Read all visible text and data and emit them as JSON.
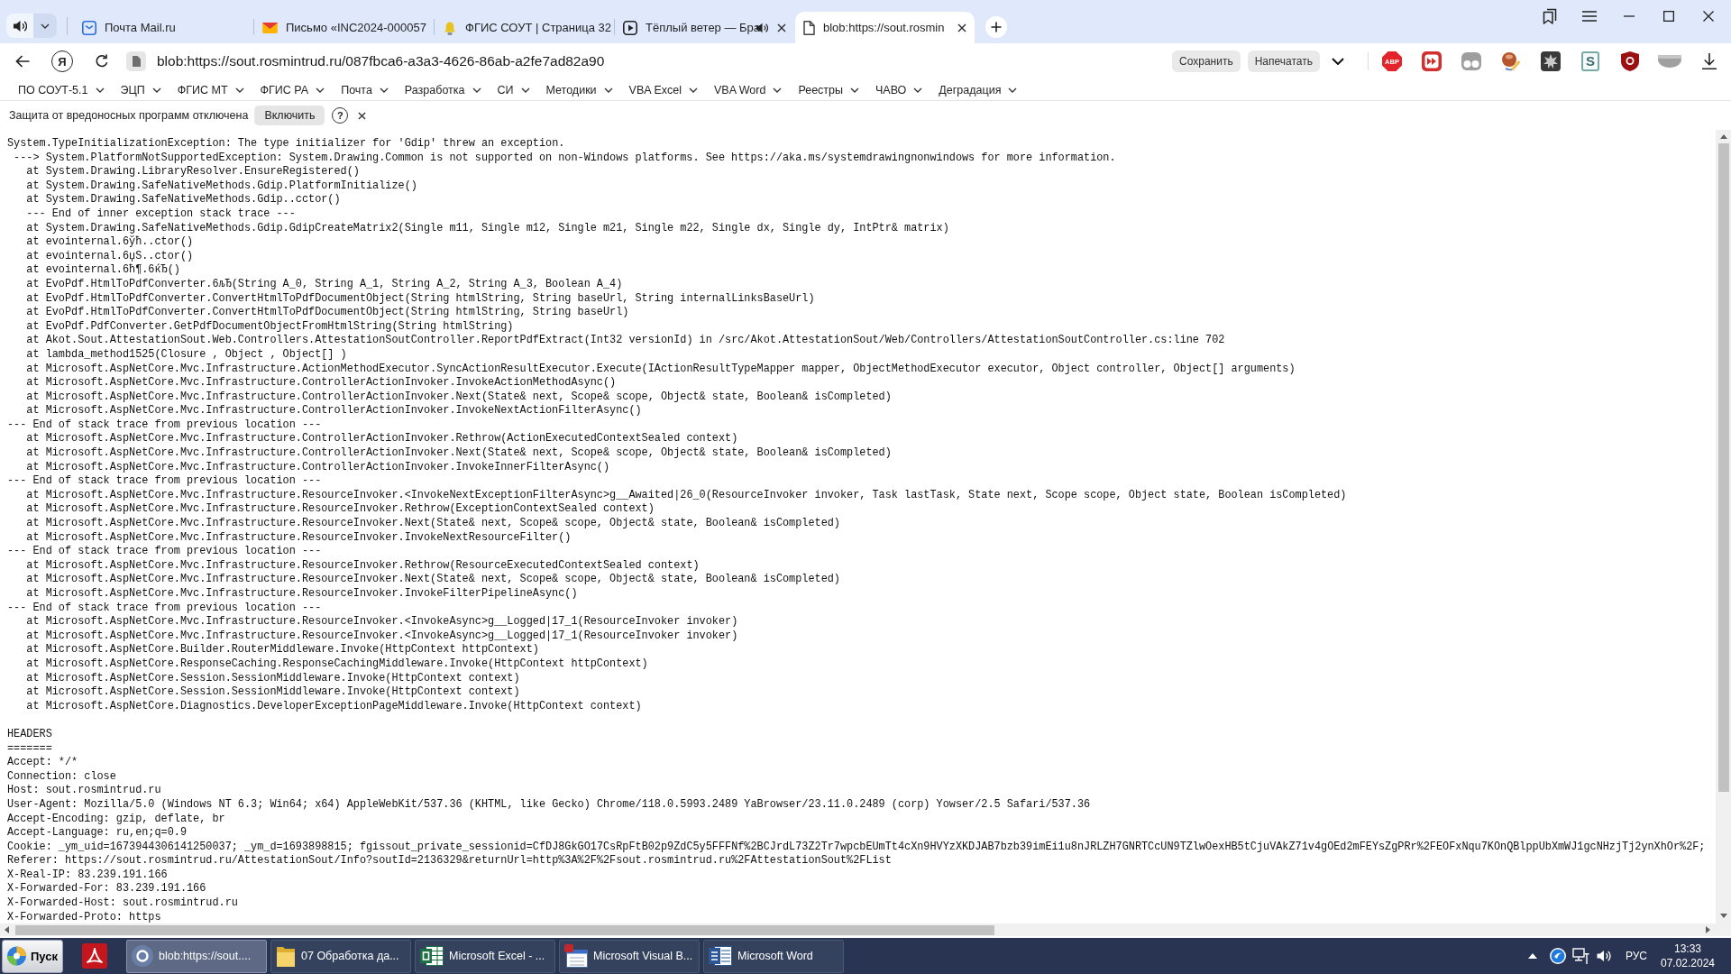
{
  "tab_strip": {
    "tabs": [
      {
        "title": "Почта Mail.ru",
        "selected": false,
        "audio": false,
        "show_close": false
      },
      {
        "title": "Письмо «INC2024-000057",
        "selected": false,
        "audio": false,
        "show_close": false
      },
      {
        "title": "ФГИС СОУТ | Страница 32",
        "selected": false,
        "audio": false,
        "show_close": false
      },
      {
        "title": "Тёплый ветер — Бра",
        "selected": false,
        "audio": true,
        "show_close": true
      },
      {
        "title": "blob:https://sout.rosmin",
        "selected": true,
        "audio": false,
        "show_close": true
      }
    ]
  },
  "toolbar": {
    "logo_letter": "Я",
    "url": "blob:https://sout.rosmintrud.ru/087fbca6-a3a3-4626-86ab-a2fe7ad82a90",
    "buttons": [
      "Сохранить",
      "Напечатать"
    ],
    "abp_badge": "ABP",
    "s_badge": "S"
  },
  "bookmarks_bar": {
    "folders": [
      "ПО СОУТ-5.1",
      "ЭЦП",
      "ФГИС МТ",
      "ФГИС РА",
      "Почта",
      "Разработка",
      "СИ",
      "Методики",
      "VBA Excel",
      "VBA Word",
      "Реестры",
      "ЧАВО",
      "Деградация"
    ]
  },
  "protection_bar": {
    "message": "Защита от вредоносных программ отключена",
    "button": "Включить",
    "help_label": "?"
  },
  "page": {
    "stack_trace": [
      {
        "kind": "exception",
        "text": "System.TypeInitializationException: The type initializer for 'Gdip' threw an exception."
      },
      {
        "kind": "cause",
        "text": "---> System.PlatformNotSupportedException: System.Drawing.Common is not supported on non-Windows platforms. See https://aka.ms/systemdrawingnonwindows for more information."
      },
      {
        "kind": "frame",
        "text": "at System.Drawing.LibraryResolver.EnsureRegistered()"
      },
      {
        "kind": "frame",
        "text": "at System.Drawing.SafeNativeMethods.Gdip.PlatformInitialize()"
      },
      {
        "kind": "frame",
        "text": "at System.Drawing.SafeNativeMethods.Gdip..cctor()"
      },
      {
        "kind": "inner_end",
        "text": "--- End of inner exception stack trace ---"
      },
      {
        "kind": "frame",
        "text": "at System.Drawing.SafeNativeMethods.Gdip.GdipCreateMatrix2(Single m11, Single m12, Single m21, Single m22, Single dx, Single dy, IntPtr& matrix)"
      },
      {
        "kind": "frame",
        "text": "at evointernal.6ўћ..ctor()"
      },
      {
        "kind": "frame",
        "text": "at evointernal.6џЅ..ctor()"
      },
      {
        "kind": "frame",
        "text": "at evointernal.6ћ¶.6ќЂ()"
      },
      {
        "kind": "frame",
        "text": "at EvoPdf.HtmlToPdfConverter.6љЂ(String A_0, String A_1, String A_2, String A_3, Boolean A_4)"
      },
      {
        "kind": "frame",
        "text": "at EvoPdf.HtmlToPdfConverter.ConvertHtmlToPdfDocumentObject(String htmlString, String baseUrl, String internalLinksBaseUrl)"
      },
      {
        "kind": "frame",
        "text": "at EvoPdf.HtmlToPdfConverter.ConvertHtmlToPdfDocumentObject(String htmlString, String baseUrl)"
      },
      {
        "kind": "frame",
        "text": "at EvoPdf.PdfConverter.GetPdfDocumentObjectFromHtmlString(String htmlString)"
      },
      {
        "kind": "frame",
        "text": "at Akot.Sout.AttestationSout.Web.Controllers.AttestationSoutController.ReportPdfExtract(Int32 versionId) in /src/Akot.AttestationSout/Web/Controllers/AttestationSoutController.cs:line 702"
      },
      {
        "kind": "frame",
        "text": "at lambda_method1525(Closure , Object , Object[] )"
      },
      {
        "kind": "frame",
        "text": "at Microsoft.AspNetCore.Mvc.Infrastructure.ActionMethodExecutor.SyncActionResultExecutor.Execute(IActionResultTypeMapper mapper, ObjectMethodExecutor executor, Object controller, Object[] arguments)"
      },
      {
        "kind": "frame",
        "text": "at Microsoft.AspNetCore.Mvc.Infrastructure.ControllerActionInvoker.InvokeActionMethodAsync()"
      },
      {
        "kind": "frame",
        "text": "at Microsoft.AspNetCore.Mvc.Infrastructure.ControllerActionInvoker.Next(State& next, Scope& scope, Object& state, Boolean& isCompleted)"
      },
      {
        "kind": "frame",
        "text": "at Microsoft.AspNetCore.Mvc.Infrastructure.ControllerActionInvoker.InvokeNextActionFilterAsync()"
      },
      {
        "kind": "location_end",
        "text": "--- End of stack trace from previous location ---"
      },
      {
        "kind": "frame",
        "text": "at Microsoft.AspNetCore.Mvc.Infrastructure.ControllerActionInvoker.Rethrow(ActionExecutedContextSealed context)"
      },
      {
        "kind": "frame",
        "text": "at Microsoft.AspNetCore.Mvc.Infrastructure.ControllerActionInvoker.Next(State& next, Scope& scope, Object& state, Boolean& isCompleted)"
      },
      {
        "kind": "frame",
        "text": "at Microsoft.AspNetCore.Mvc.Infrastructure.ControllerActionInvoker.InvokeInnerFilterAsync()"
      },
      {
        "kind": "location_end",
        "text": "--- End of stack trace from previous location ---"
      },
      {
        "kind": "frame",
        "text": "at Microsoft.AspNetCore.Mvc.Infrastructure.ResourceInvoker.<InvokeNextExceptionFilterAsync>g__Awaited|26_0(ResourceInvoker invoker, Task lastTask, State next, Scope scope, Object state, Boolean isCompleted)"
      },
      {
        "kind": "frame",
        "text": "at Microsoft.AspNetCore.Mvc.Infrastructure.ResourceInvoker.Rethrow(ExceptionContextSealed context)"
      },
      {
        "kind": "frame",
        "text": "at Microsoft.AspNetCore.Mvc.Infrastructure.ResourceInvoker.Next(State& next, Scope& scope, Object& state, Boolean& isCompleted)"
      },
      {
        "kind": "frame",
        "text": "at Microsoft.AspNetCore.Mvc.Infrastructure.ResourceInvoker.InvokeNextResourceFilter()"
      },
      {
        "kind": "location_end",
        "text": "--- End of stack trace from previous location ---"
      },
      {
        "kind": "frame",
        "text": "at Microsoft.AspNetCore.Mvc.Infrastructure.ResourceInvoker.Rethrow(ResourceExecutedContextSealed context)"
      },
      {
        "kind": "frame",
        "text": "at Microsoft.AspNetCore.Mvc.Infrastructure.ResourceInvoker.Next(State& next, Scope& scope, Object& state, Boolean& isCompleted)"
      },
      {
        "kind": "frame",
        "text": "at Microsoft.AspNetCore.Mvc.Infrastructure.ResourceInvoker.InvokeFilterPipelineAsync()"
      },
      {
        "kind": "location_end",
        "text": "--- End of stack trace from previous location ---"
      },
      {
        "kind": "frame",
        "text": "at Microsoft.AspNetCore.Mvc.Infrastructure.ResourceInvoker.<InvokeAsync>g__Logged|17_1(ResourceInvoker invoker)"
      },
      {
        "kind": "frame",
        "text": "at Microsoft.AspNetCore.Mvc.Infrastructure.ResourceInvoker.<InvokeAsync>g__Logged|17_1(ResourceInvoker invoker)"
      },
      {
        "kind": "frame",
        "text": "at Microsoft.AspNetCore.Builder.RouterMiddleware.Invoke(HttpContext httpContext)"
      },
      {
        "kind": "frame",
        "text": "at Microsoft.AspNetCore.ResponseCaching.ResponseCachingMiddleware.Invoke(HttpContext httpContext)"
      },
      {
        "kind": "frame",
        "text": "at Microsoft.AspNetCore.Session.SessionMiddleware.Invoke(HttpContext context)"
      },
      {
        "kind": "frame",
        "text": "at Microsoft.AspNetCore.Session.SessionMiddleware.Invoke(HttpContext context)"
      },
      {
        "kind": "frame",
        "text": "at Microsoft.AspNetCore.Diagnostics.DeveloperExceptionPageMiddleware.Invoke(HttpContext context)"
      }
    ],
    "headers": {
      "title": "HEADERS",
      "rule": "=======",
      "lines": [
        "Accept: */*",
        "Connection: close",
        "Host: sout.rosmintrud.ru",
        "User-Agent: Mozilla/5.0 (Windows NT 6.3; Win64; x64) AppleWebKit/537.36 (KHTML, like Gecko) Chrome/118.0.5993.2489 YaBrowser/23.11.0.2489 (corp) Yowser/2.5 Safari/537.36",
        "Accept-Encoding: gzip, deflate, br",
        "Accept-Language: ru,en;q=0.9",
        "Cookie: _ym_uid=1673944306141250037; _ym_d=1693898815; fgissout_private_sessionid=CfDJ8GkGO17CsRpFtB02p9ZdC5y5FFFNf%2BCJrdL73Z2Tr7wpcbEUmTt4cXn9HVYzXKDJAB7bzb39imEi1u8nJRLZH7GNRTCcUN9TZlwOexHB5tCjuVAkZ71v4gOEd2mFEYsZgPRr%2FEOFxNqu7KOnQBlppUbXmWJ1gcNHzjTj2ynXhOr%2F;",
        "Referer: https://sout.rosmintrud.ru/AttestationSout/Info?soutId=2136329&returnUrl=http%3A%2F%2Fsout.rosmintrud.ru%2FAttestationSout%2FList",
        "X-Real-IP: 83.239.191.166",
        "X-Forwarded-For: 83.239.191.166",
        "X-Forwarded-Host: sout.rosmintrud.ru",
        "X-Forwarded-Proto: https"
      ]
    }
  },
  "taskbar": {
    "start": "Пуск",
    "tasks": [
      {
        "label": "blob:https://sout....",
        "selected": true
      },
      {
        "label": "07 Обработка да...",
        "selected": false
      },
      {
        "label": "Microsoft Excel - ...",
        "selected": false
      },
      {
        "label": "Microsoft Visual B...",
        "selected": false
      },
      {
        "label": "Microsoft Word",
        "selected": false
      }
    ],
    "tray": {
      "language": "РУС",
      "time": "13:33",
      "date": "07.02.2024"
    }
  }
}
